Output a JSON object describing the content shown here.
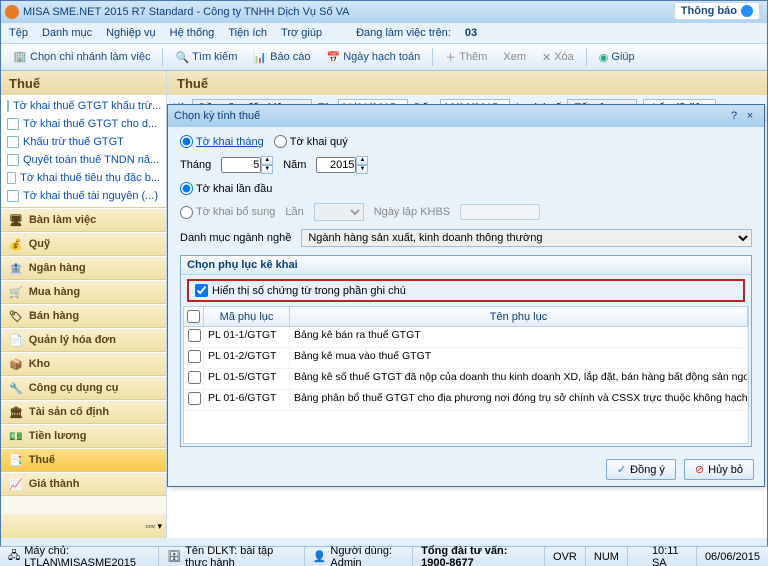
{
  "title": "MISA SME.NET 2015 R7 Standard - Công ty TNHH Dịch Vụ Số VA",
  "menu": [
    "Tệp",
    "Danh mục",
    "Nghiệp vụ",
    "Hệ thống",
    "Tiện ích",
    "Trợ giúp"
  ],
  "working_label": "Đang làm việc trên:",
  "working_value": "03",
  "toolbar": {
    "branch": "Chọn chi nhánh làm việc",
    "find": "Tìm kiếm",
    "report": "Báo cáo",
    "plan": "Ngày hạch toán",
    "add": "Thêm",
    "view": "Xem",
    "del": "Xóa",
    "help": "Giúp"
  },
  "notify": "Thông báo",
  "sidebar": {
    "title": "Thuế",
    "tree": [
      "Tờ khai thuế GTGT khấu trừ...",
      "Tờ khai thuế GTGT cho d...",
      "Khấu trừ thuế GTGT",
      "Quyết toán thuế TNDN nă...",
      "Tờ khai thuế tiêu thụ đặc b...",
      "Tờ khai thuế tài nguyên (...)"
    ],
    "btns": [
      "Bàn làm việc",
      "Quỹ",
      "Ngân hàng",
      "Mua hàng",
      "Bán hàng",
      "Quản lý hóa đơn",
      "Kho",
      "Công cụ dụng cụ",
      "Tài sản cố định",
      "Tiền lương",
      "Thuế",
      "Giá thành"
    ]
  },
  "main": {
    "title": "Thuế",
    "filter": {
      "ky": "Kỳ",
      "ky_val": "Đầu năm đến hiện tại",
      "tu": "Từ",
      "tu_val": "01/01/2015",
      "den": "Đến",
      "den_val": "06/06/2015",
      "loai": "Loại thuế",
      "loai_val": "Tất cả",
      "btn": "Lấy dữ liệu"
    }
  },
  "dialog": {
    "title": "Chọn kỳ tính thuế",
    "period_month": "Tờ khai tháng",
    "period_quarter": "Tờ khai quý",
    "thang": "Tháng",
    "thang_val": "5",
    "nam": "Năm",
    "nam_val": "2015",
    "first": "Tờ khai lần đầu",
    "addl": "Tờ khai bổ sung",
    "lan": "Lần",
    "khbs": "Ngày lập KHBS",
    "industry_label": "Danh mục ngành nghề",
    "industry_val": "Ngành hàng sản xuất, kinh doanh thông thường",
    "group": "Chọn phụ lục kê khai",
    "highlight": "Hiển thị số chứng từ trong phần ghi chú",
    "col_code": "Mã phụ lục",
    "col_name": "Tên phụ lục",
    "rows": [
      {
        "code": "PL 01-1/GTGT",
        "name": "Bảng kê bán ra thuế GTGT"
      },
      {
        "code": "PL 01-2/GTGT",
        "name": "Bảng kê mua vào thuế GTGT"
      },
      {
        "code": "PL 01-5/GTGT",
        "name": "Bảng kê số thuế GTGT đã nộp của doanh thu kinh doanh XD, lắp đặt, bán hàng bất động sản ngoại tỉnh"
      },
      {
        "code": "PL 01-6/GTGT",
        "name": "Bảng phân bổ thuế GTGT cho địa phương nơi đóng trụ sở chính và CSSX trực thuộc không hạch toán k"
      }
    ],
    "ok": "Đồng ý",
    "cancel": "Hủy bỏ"
  },
  "status": {
    "server": "Máy chủ: LTLAN\\MISASME2015",
    "dlkt": "Tên DLKT: bài tập thực hành",
    "user": "Người dùng: Admin",
    "hotline": "Tổng đài tư vấn: 1900-8677",
    "ovr": "OVR",
    "num": "NUM",
    "time": "10:11 SA",
    "date": "06/06/2015"
  }
}
